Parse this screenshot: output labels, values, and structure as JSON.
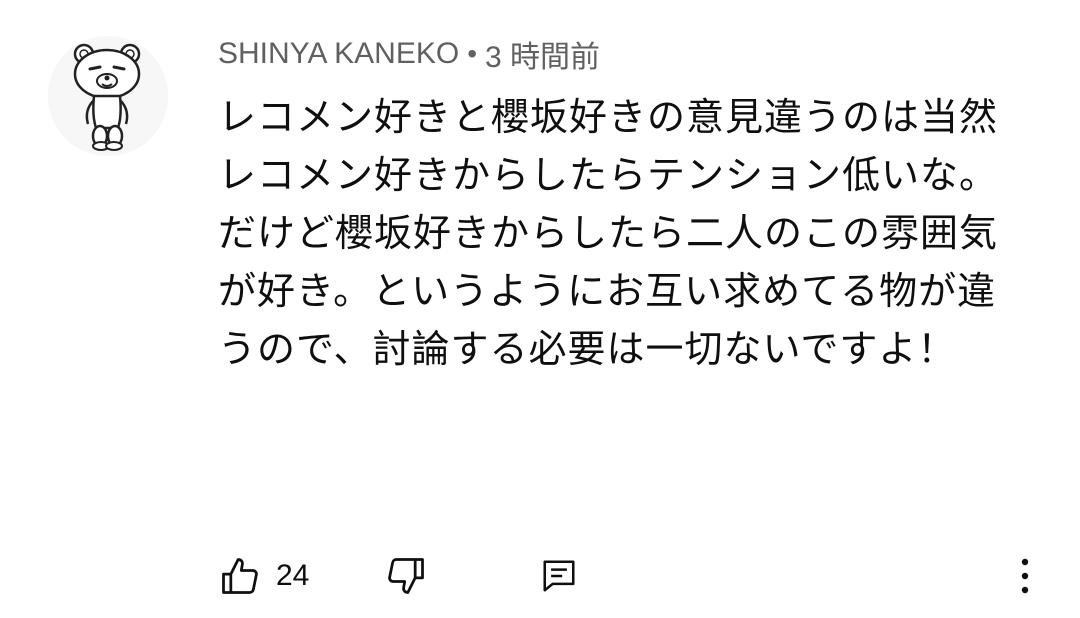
{
  "comment": {
    "author": "SHINYA KANEKO",
    "separator": "•",
    "time": "3 時間前",
    "text": "レコメン好きと櫻坂好きの意見違うのは当然\nレコメン好きからしたらテンション低いな。だけど櫻坂好きからしたら二人のこの雰囲気が好き。というようにお互い求めてる物が違うので、討論する必要は一切ないですよ！",
    "like_count": "24"
  },
  "icons": {
    "avatar": "bear-avatar",
    "like": "thumb-up-icon",
    "dislike": "thumb-down-icon",
    "reply": "reply-comment-icon",
    "more": "more-vertical-icon"
  },
  "colors": {
    "text_primary": "#0f0f0f",
    "text_secondary": "#606060",
    "background": "#ffffff"
  }
}
